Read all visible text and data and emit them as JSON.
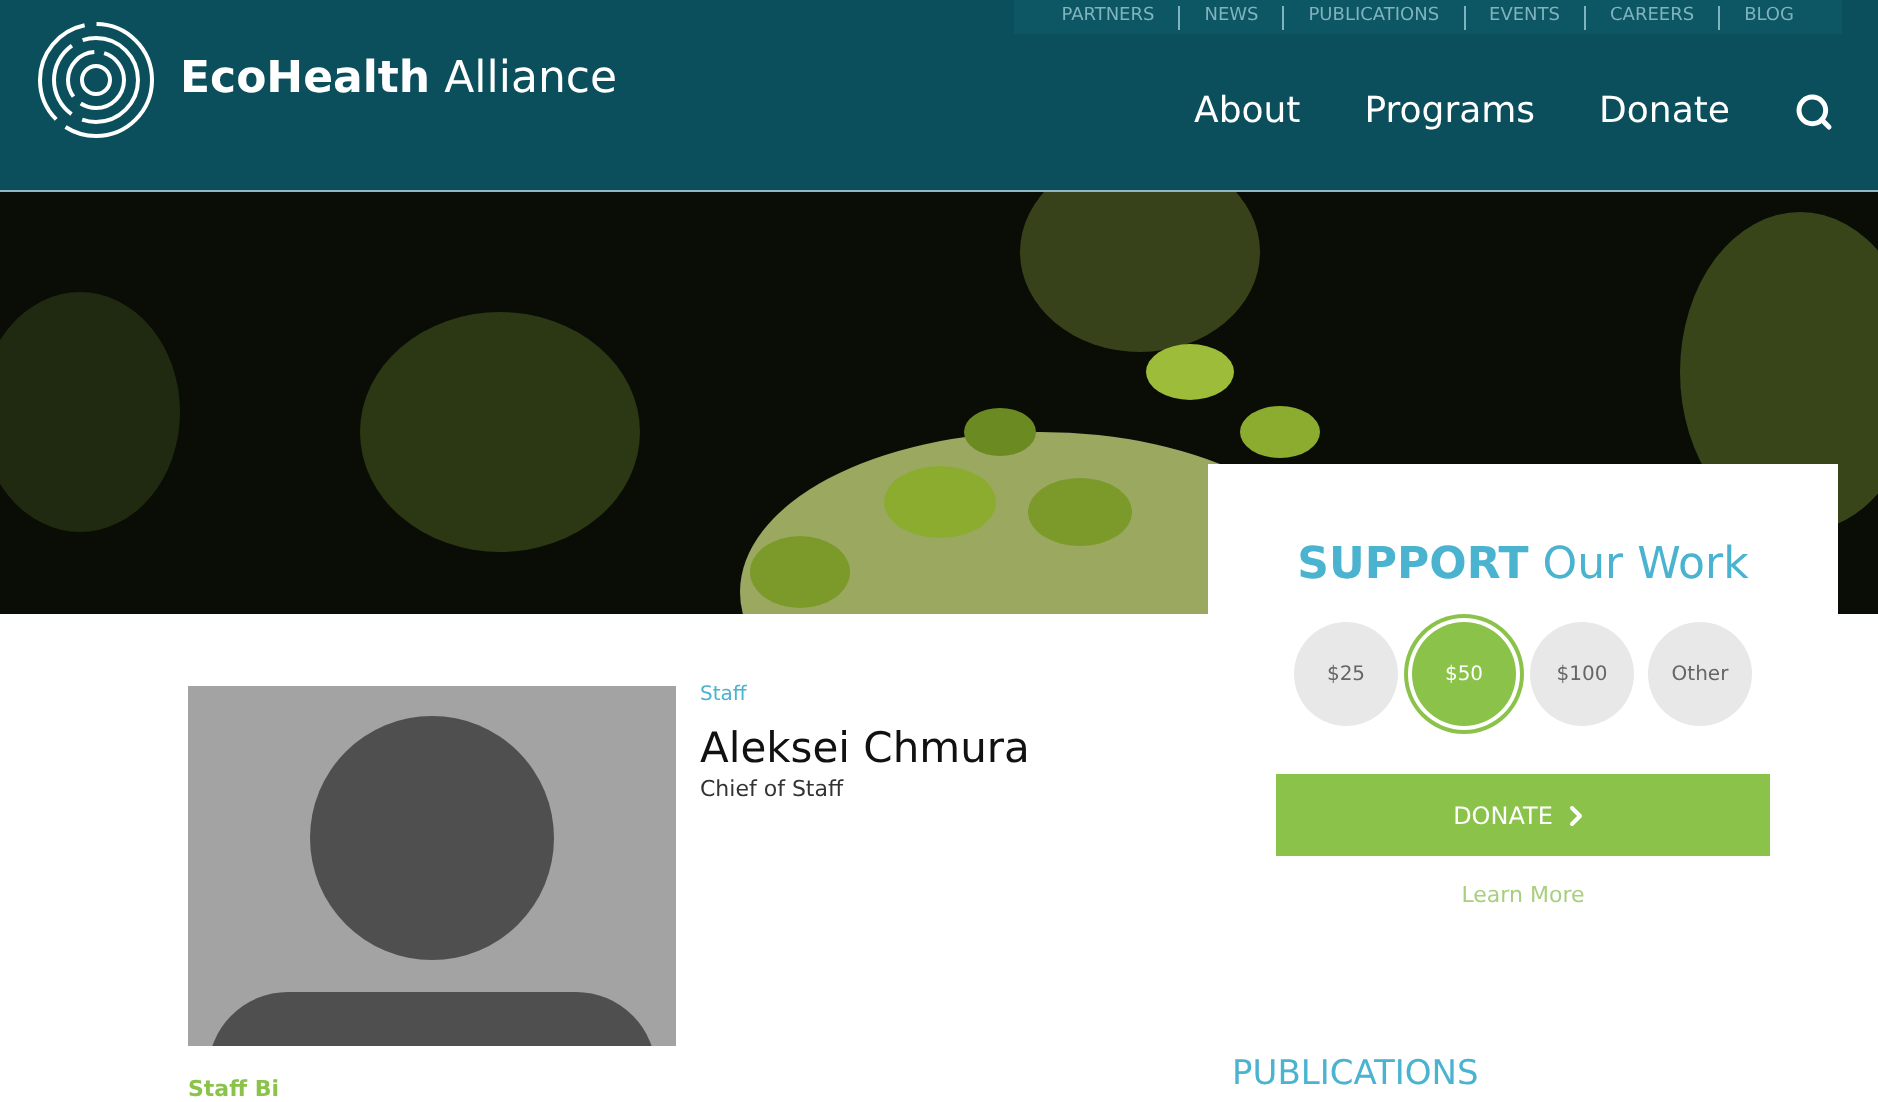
{
  "header": {
    "logo_text": "EcoHealth",
    "logo_text_light": "Alliance",
    "top_links": [
      "PARTNERS",
      "NEWS",
      "PUBLICATIONS",
      "EVENTS",
      "CAREERS",
      "BLOG"
    ],
    "nav": [
      "About",
      "Programs",
      "Donate"
    ]
  },
  "donate": {
    "title_bold": "SUPPORT",
    "title_light": "Our Work",
    "amounts": [
      {
        "label": "$25",
        "selected": false
      },
      {
        "label": "$50",
        "selected": true
      },
      {
        "label": "$100",
        "selected": false
      },
      {
        "label": "Other",
        "selected": false
      }
    ],
    "button": "DONATE",
    "link": "Learn More"
  },
  "profile": {
    "category": "Staff",
    "name": "Aleksei Chmura",
    "role": "Chief of Staff",
    "section": "Staff Bi"
  },
  "sidebar": {
    "heading": "PUBLICATIONS"
  }
}
